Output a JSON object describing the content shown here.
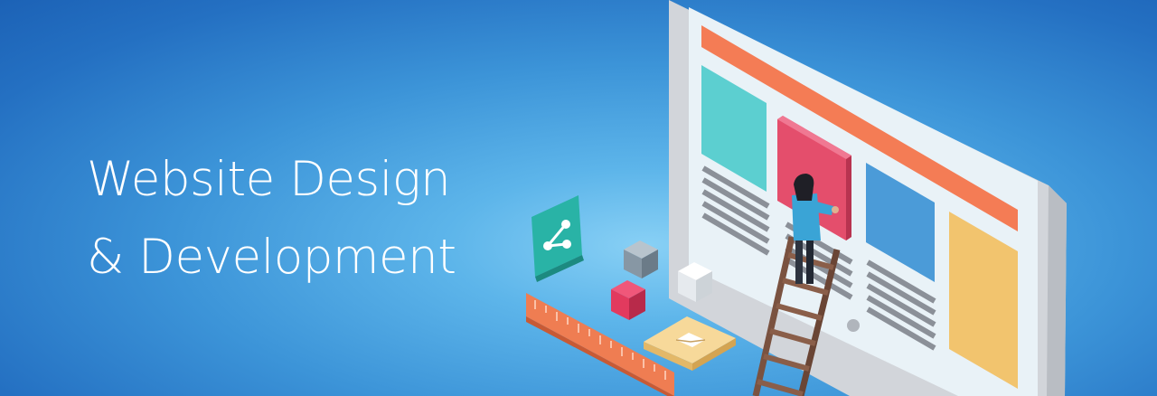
{
  "banner": {
    "headline_line1": "Website Design",
    "headline_line2": "& Development"
  },
  "illustration": {
    "subject": "monitor with web layout, person on ladder placing a content block",
    "icons": [
      "share-icon",
      "mail-icon",
      "ruler-icon",
      "cube-icon"
    ]
  },
  "colors": {
    "background_center": "#88d0f5",
    "background_edge": "#1c62b6",
    "header_bar": "#f47c55",
    "teal_block": "#5ccfd0",
    "pink_block": "#e44e6c",
    "blue_block": "#4b9bd8",
    "yellow_block": "#f2c46e",
    "monitor_frame": "#d3d6db"
  }
}
